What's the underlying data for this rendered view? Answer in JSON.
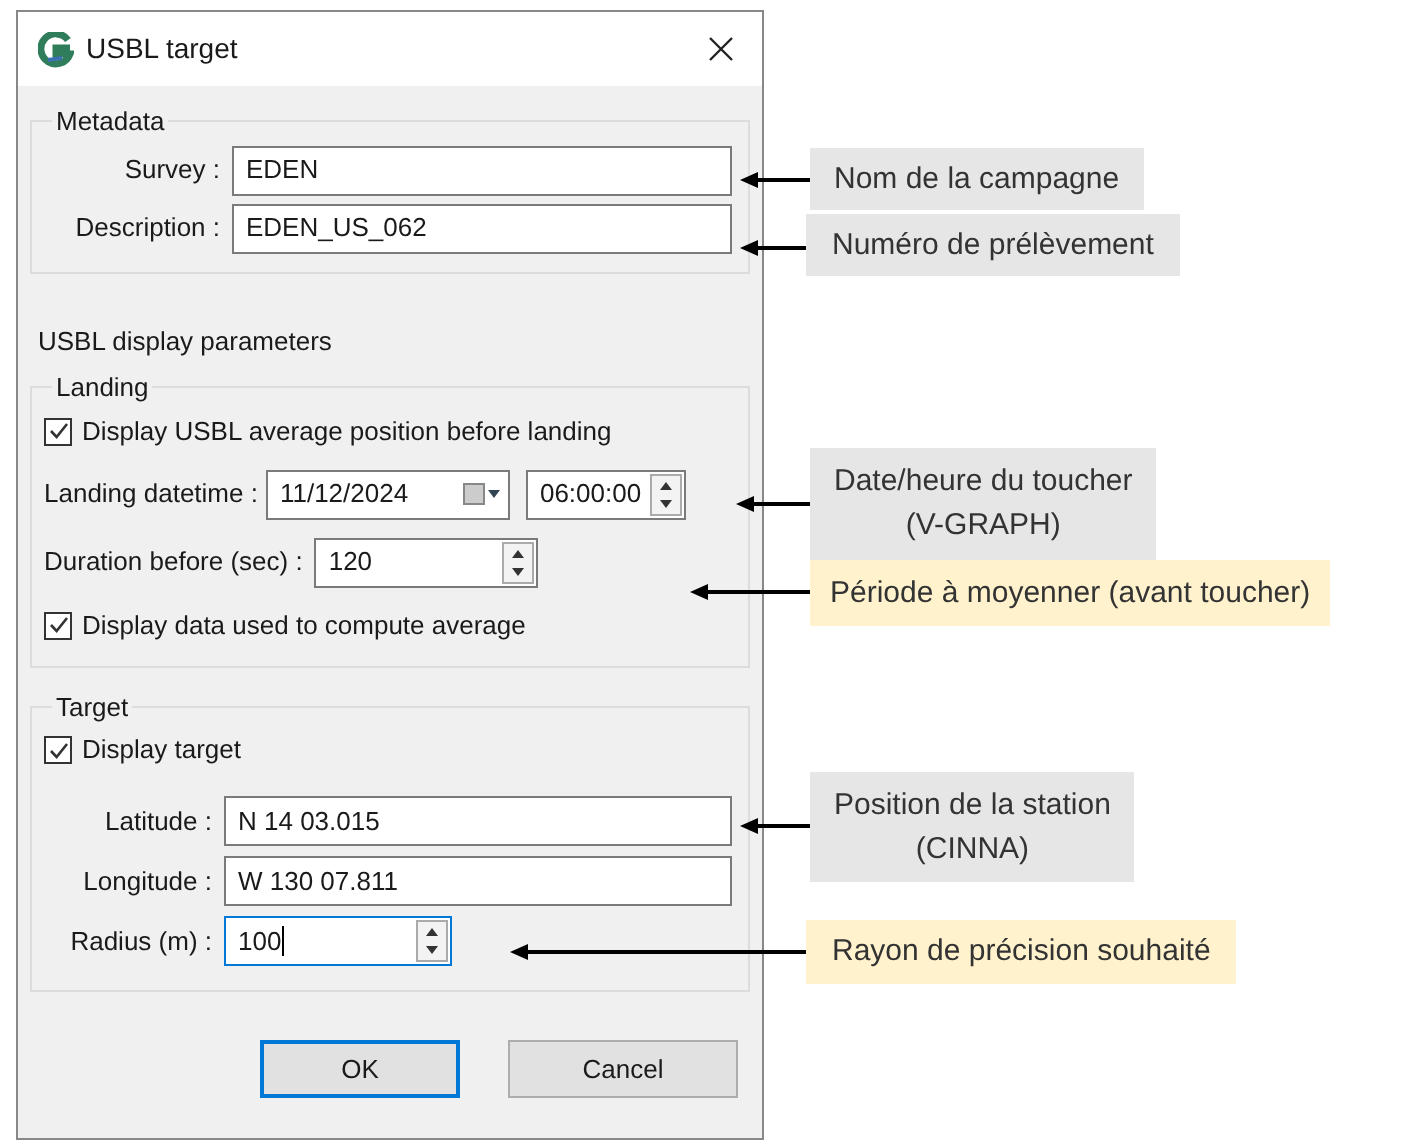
{
  "window": {
    "title": "USBL target"
  },
  "metadata": {
    "title": "Metadata",
    "fields": [
      {
        "label": "Survey :",
        "value": "EDEN"
      },
      {
        "label": "Description :",
        "value": "EDEN_US_062"
      }
    ]
  },
  "section_title": "USBL display parameters",
  "landing": {
    "title": "Landing",
    "average_checkbox": {
      "label": "Display USBL average position before landing",
      "checked": true
    },
    "datetime": {
      "label": "Landing datetime :",
      "date": "11/12/2024",
      "time": "06:00:00"
    },
    "duration": {
      "label": "Duration before (sec) :",
      "value": "120"
    },
    "data_checkbox": {
      "label": "Display data used to compute average",
      "checked": true
    }
  },
  "target": {
    "title": "Target",
    "display_checkbox": {
      "label": "Display target",
      "checked": true
    },
    "latitude": {
      "label": "Latitude :",
      "value": "N 14 03.015"
    },
    "longitude": {
      "label": "Longitude :",
      "value": "W 130 07.811"
    },
    "radius": {
      "label": "Radius (m) :",
      "value": "100",
      "focused": true
    }
  },
  "buttons": [
    {
      "label": "OK",
      "default": true
    },
    {
      "label": "Cancel",
      "default": false
    }
  ],
  "annotations": [
    {
      "text": "Nom de la campagne",
      "color": "#e7e6e6"
    },
    {
      "text": "Numéro de prélèvement",
      "color": "#e7e6e6"
    },
    {
      "text": "Date/heure du toucher\n(V-GRAPH)",
      "color": "#e7e6e6"
    },
    {
      "text": "Période à moyenner (avant toucher)",
      "color": "#fff2cc"
    },
    {
      "text": "Position de la station\n(CINNA)",
      "color": "#e7e6e6"
    },
    {
      "text": "Rayon de précision souhaité",
      "color": "#fff2cc"
    }
  ]
}
